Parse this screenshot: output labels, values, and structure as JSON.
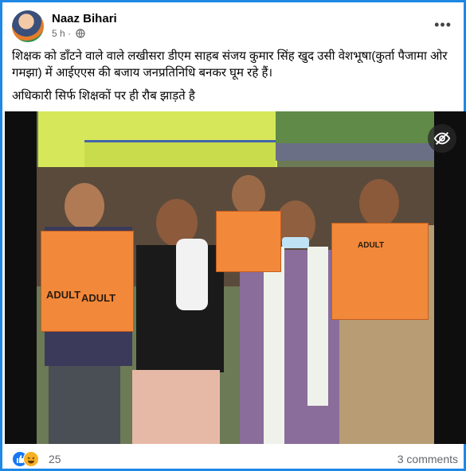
{
  "post": {
    "author": "Naaz Bihari",
    "time": "5 h",
    "separator": "·",
    "more_label": "•••",
    "text_line1": "शिक्षक को डाँटने वाले वाले लखीसरा डीएम साहब संजय कुमार सिंह खुद उसी वेशभूषा(कुर्ता पैजामा ओर गमझा) में आईएएस की बजाय जनप्रतिनिधि बनकर घूम रहे हैं।",
    "text_line2": "अधिकारी सिर्फ शिक्षकों पर ही रौब झाड़ते है",
    "photo_vest_text": [
      "ADULT",
      "ADULT",
      "ADULT"
    ]
  },
  "footer": {
    "reaction_count": "25",
    "comments": "3 comments"
  },
  "colors": {
    "frame": "#1e88e5",
    "like": "#1877f2",
    "haha": "#f7b125",
    "vest": "#f2883a"
  },
  "icons": {
    "privacy": "globe-icon",
    "more": "more-options-icon",
    "hide": "eye-slash-icon"
  }
}
